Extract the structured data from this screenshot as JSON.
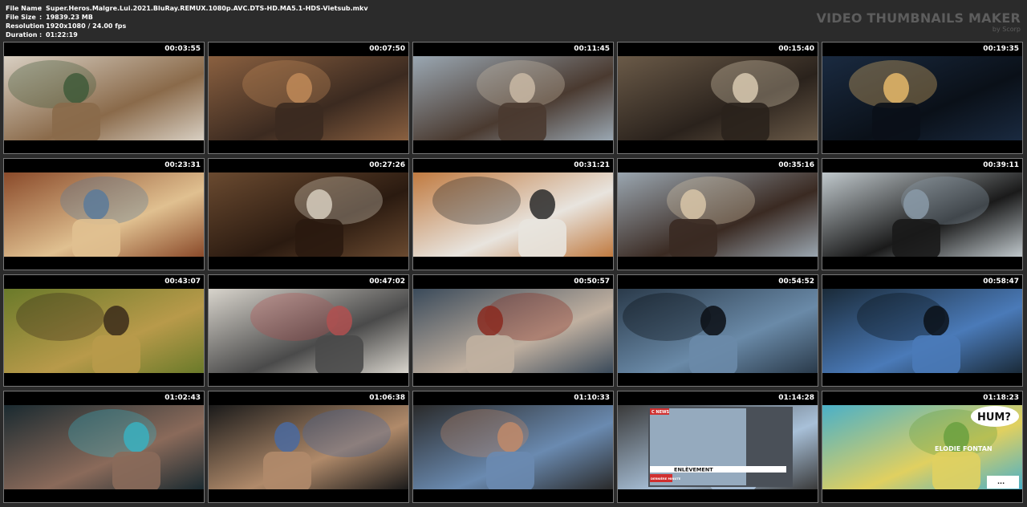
{
  "file_info": {
    "rows": [
      {
        "label": "File Name",
        "value": "Super.Heros.Malgre.Lui.2021.BluRay.REMUX.1080p.AVC.DTS-HD.MA5.1-HDS-Vietsub.mkv"
      },
      {
        "label": "File Size",
        "value": "19839.23 MB"
      },
      {
        "label": "Resolution",
        "value": "1920x1080 / 24.00 fps"
      },
      {
        "label": "Duration",
        "value": "01:22:19"
      }
    ],
    "separator": ":"
  },
  "brand": {
    "title": "VIDEO THUMBNAILS MAKER",
    "subtitle": "by Scorp"
  },
  "thumbnails": [
    {
      "timestamp": "00:03:55",
      "scene": "living-room-boxes",
      "colors": [
        "#d8cfc2",
        "#8a6a4a",
        "#3f5a3a"
      ]
    },
    {
      "timestamp": "00:07:50",
      "scene": "man-beanie-sofa",
      "colors": [
        "#8a6040",
        "#3b2a20",
        "#c08a58"
      ]
    },
    {
      "timestamp": "00:11:45",
      "scene": "man-close-up-room",
      "colors": [
        "#9aa7b2",
        "#4a3a30",
        "#c9b9a5"
      ]
    },
    {
      "timestamp": "00:15:40",
      "scene": "warehouse-night",
      "colors": [
        "#6a5a48",
        "#2a221c",
        "#d8c9b0"
      ]
    },
    {
      "timestamp": "00:19:35",
      "scene": "street-night",
      "colors": [
        "#1a2a40",
        "#0a1018",
        "#e6b86a"
      ]
    },
    {
      "timestamp": "00:23:31",
      "scene": "couple-sofa",
      "colors": [
        "#8a4a2a",
        "#e0c090",
        "#5a7a9a"
      ]
    },
    {
      "timestamp": "00:27:26",
      "scene": "man-smiling",
      "colors": [
        "#6a4a30",
        "#2a1a10",
        "#d6cdbd"
      ]
    },
    {
      "timestamp": "00:31:21",
      "scene": "notebook-desk",
      "colors": [
        "#c07a40",
        "#e8e4de",
        "#2a2a2a"
      ]
    },
    {
      "timestamp": "00:35:16",
      "scene": "car-two-people",
      "colors": [
        "#9aa6b0",
        "#3a2a22",
        "#d8c6a8"
      ]
    },
    {
      "timestamp": "00:39:11",
      "scene": "woman-in-car",
      "colors": [
        "#c0c8cc",
        "#1a1a1a",
        "#8a9aa8"
      ]
    },
    {
      "timestamp": "00:43:07",
      "scene": "woman-foliage",
      "colors": [
        "#6a7a2a",
        "#b89a4a",
        "#3a2a1a"
      ]
    },
    {
      "timestamp": "00:47:02",
      "scene": "man-doorway",
      "colors": [
        "#d8d4cc",
        "#4a4a4a",
        "#b05050"
      ]
    },
    {
      "timestamp": "00:50:57",
      "scene": "crowd-costume",
      "colors": [
        "#3a4a5a",
        "#c0b0a0",
        "#8a2a20"
      ]
    },
    {
      "timestamp": "00:54:52",
      "scene": "child-hoodie-car",
      "colors": [
        "#2a3a4a",
        "#6a8aa8",
        "#0a0e14"
      ]
    },
    {
      "timestamp": "00:58:47",
      "scene": "night-road-van",
      "colors": [
        "#1a2a38",
        "#4a7ab8",
        "#0a1018"
      ]
    },
    {
      "timestamp": "01:02:43",
      "scene": "man-driving-night",
      "colors": [
        "#1a2a30",
        "#8a6a5a",
        "#3ab0c0"
      ]
    },
    {
      "timestamp": "01:06:38",
      "scene": "man-glasses-object",
      "colors": [
        "#1a1a1a",
        "#b08a6a",
        "#4a6aa0"
      ]
    },
    {
      "timestamp": "01:10:33",
      "scene": "group-night-street",
      "colors": [
        "#2a2a2a",
        "#6a8ab0",
        "#c08a6a"
      ]
    },
    {
      "timestamp": "01:14:28",
      "scene": "news-tv-screen",
      "colors": [
        "#3a3a3a",
        "#a8c0d8",
        "#d03030"
      ],
      "overlay": {
        "badge": "C NEWS",
        "headline": "ENLÈVEMENT",
        "tag": "DERNIÈRE MINUTE"
      }
    },
    {
      "timestamp": "01:18:23",
      "scene": "comic-woman",
      "colors": [
        "#4ab0c8",
        "#e0d060",
        "#6aa040"
      ],
      "overlay": {
        "bubble": "HUM?",
        "name": "ELODIE FONTAN",
        "dots": "..."
      }
    }
  ]
}
